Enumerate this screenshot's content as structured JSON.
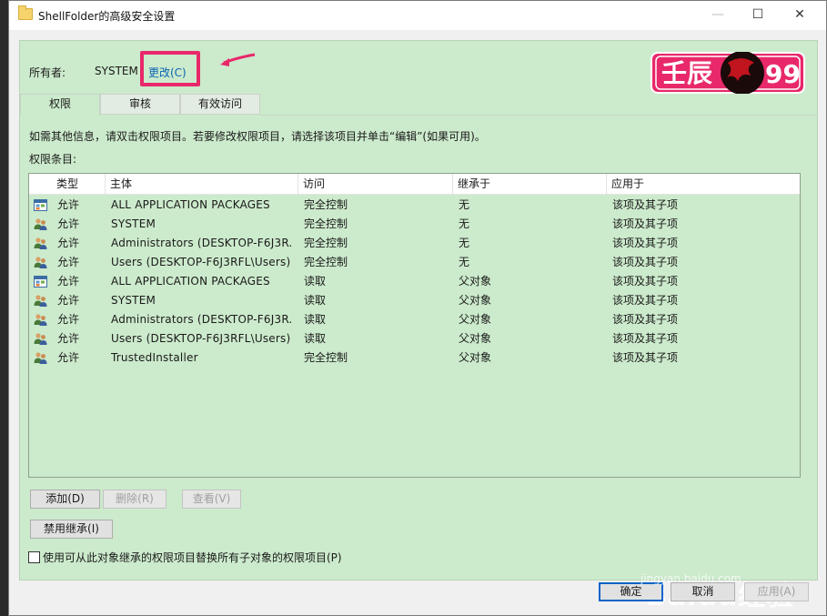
{
  "window": {
    "title": "ShellFolder的高级安全设置",
    "minimize": "—",
    "maximize": "☐",
    "close": "✕"
  },
  "owner": {
    "label": "所有者:",
    "value": "SYSTEM",
    "change_link": "更改(C)"
  },
  "logo": {
    "text_left": "壬辰",
    "text_right": "99",
    "colors": {
      "border": "#e8286a",
      "text": "#ffffff",
      "dragon": "#c0141e"
    }
  },
  "tabs": [
    "权限",
    "审核",
    "有效访问"
  ],
  "info_text": "如需其他信息，请双击权限项目。若要修改权限项目，请选择该项目并单击“编辑”(如果可用)。",
  "entries_label": "权限条目:",
  "columns": [
    "类型",
    "主体",
    "访问",
    "继承于",
    "应用于"
  ],
  "rows": [
    {
      "icon": "app-packages-icon",
      "type": "允许",
      "subject": "ALL APPLICATION PACKAGES",
      "access": "完全控制",
      "inherited": "无",
      "applies": "该项及其子项"
    },
    {
      "icon": "users-icon",
      "type": "允许",
      "subject": "SYSTEM",
      "access": "完全控制",
      "inherited": "无",
      "applies": "该项及其子项"
    },
    {
      "icon": "users-icon",
      "type": "允许",
      "subject": "Administrators (DESKTOP-F6J3R...",
      "access": "完全控制",
      "inherited": "无",
      "applies": "该项及其子项"
    },
    {
      "icon": "users-icon",
      "type": "允许",
      "subject": "Users (DESKTOP-F6J3RFL\\Users)",
      "access": "完全控制",
      "inherited": "无",
      "applies": "该项及其子项"
    },
    {
      "icon": "app-packages-icon",
      "type": "允许",
      "subject": "ALL APPLICATION PACKAGES",
      "access": "读取",
      "inherited": "父对象",
      "applies": "该项及其子项"
    },
    {
      "icon": "users-icon",
      "type": "允许",
      "subject": "SYSTEM",
      "access": "读取",
      "inherited": "父对象",
      "applies": "该项及其子项"
    },
    {
      "icon": "users-icon",
      "type": "允许",
      "subject": "Administrators (DESKTOP-F6J3R...",
      "access": "读取",
      "inherited": "父对象",
      "applies": "该项及其子项"
    },
    {
      "icon": "users-icon",
      "type": "允许",
      "subject": "Users (DESKTOP-F6J3RFL\\Users)",
      "access": "读取",
      "inherited": "父对象",
      "applies": "该项及其子项"
    },
    {
      "icon": "users-icon",
      "type": "允许",
      "subject": "TrustedInstaller",
      "access": "完全控制",
      "inherited": "父对象",
      "applies": "该项及其子项"
    }
  ],
  "buttons": {
    "add": "添加(D)",
    "delete": "删除(R)",
    "view": "查看(V)",
    "disable_inheritance": "禁用继承(I)"
  },
  "checkbox_label": "使用可从此对象继承的权限项目替换所有子对象的权限项目(P)",
  "dialog_buttons": {
    "ok": "确定",
    "cancel": "取消",
    "apply": "应用(A)"
  },
  "watermark": {
    "main": "Baidu经验",
    "sub": "jingyan.baidu.com"
  },
  "colors": {
    "panel_bg": "#cceacc",
    "highlight": "#e8286a",
    "link": "#0a64b4"
  }
}
